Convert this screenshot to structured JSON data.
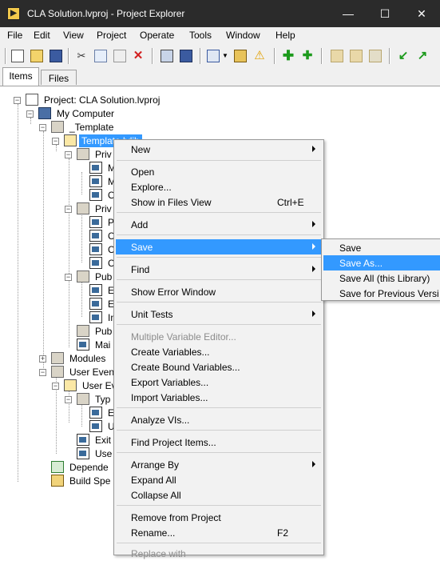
{
  "window": {
    "title": "CLA Solution.lvproj - Project Explorer",
    "app_icon": "labview-project-icon",
    "minimize": "—",
    "maximize": "☐",
    "close": "✕"
  },
  "menubar": [
    "File",
    "Edit",
    "View",
    "Project",
    "Operate",
    "Tools",
    "Window",
    "Help"
  ],
  "toolbar": {
    "icons": [
      "new-icon",
      "open-icon",
      "save-all-icon",
      "cut-icon",
      "copy-icon",
      "paste-icon",
      "delete-icon",
      "build-icon",
      "deploy-icon",
      "view-options-icon",
      "dropdown-icon",
      "properties-icon",
      "warning-icon",
      "add-icon",
      "add-item-icon",
      "collapse-icon",
      "expand-icon",
      "sync-icon",
      "back-icon",
      "forward-icon"
    ]
  },
  "tabs": [
    "Items",
    "Files"
  ],
  "tree": {
    "project": "Project: CLA Solution.lvproj",
    "computer": "My Computer",
    "template_folder": "_Template",
    "template_lib": "Template.lvlib",
    "priv1": "Priv",
    "m1": "M",
    "m2": "M",
    "o1": "O",
    "priv2": "Priv",
    "p1": "P",
    "c1": "C",
    "c2": "C",
    "c3": "C",
    "pub1": "Pub",
    "e1": "E",
    "e2": "E",
    "i1": "In",
    "pub2": "Pub",
    "mai": "Mai",
    "modules": "Modules",
    "user_events": "User Even",
    "user_ev_lib": "User Ev",
    "type": "Typ",
    "e3": "E",
    "u1": "U",
    "exit": "Exit",
    "use": "Use",
    "depend": "Depende",
    "build": "Build Spe"
  },
  "context_menu": {
    "new": "New",
    "open": "Open",
    "explore": "Explore...",
    "show_files": "Show in Files View",
    "show_files_shortcut": "Ctrl+E",
    "add": "Add",
    "save": "Save",
    "find": "Find",
    "show_error": "Show Error Window",
    "unit_tests": "Unit Tests",
    "mve": "Multiple Variable Editor...",
    "create_vars": "Create Variables...",
    "create_bound": "Create Bound Variables...",
    "export_vars": "Export Variables...",
    "import_vars": "Import Variables...",
    "analyze": "Analyze VIs...",
    "find_items": "Find Project Items...",
    "arrange": "Arrange By",
    "expand_all": "Expand All",
    "collapse_all": "Collapse All",
    "remove": "Remove from Project",
    "rename": "Rename...",
    "rename_shortcut": "F2",
    "replace_with": "Replace with"
  },
  "save_submenu": {
    "save": "Save",
    "save_as": "Save As...",
    "save_all": "Save All (this Library)",
    "save_prev": "Save for Previous Versi"
  },
  "colors": {
    "selection": "#3399ff",
    "titlebar": "#2b2b2b"
  }
}
